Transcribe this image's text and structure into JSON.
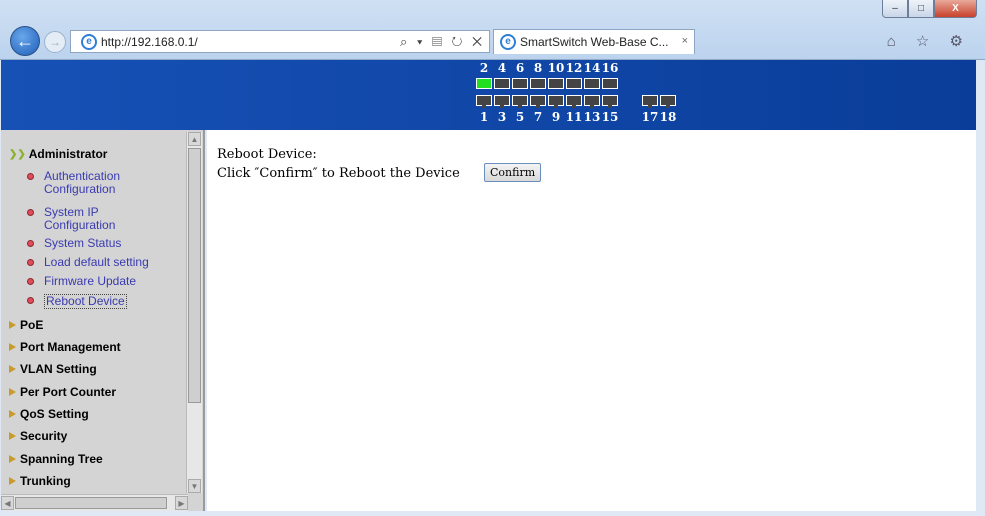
{
  "browser": {
    "url": "http://192.168.0.1/",
    "tab_title": "SmartSwitch Web-Base C...",
    "tab_close": "×",
    "address_tools": "⌕ ▾ ▤ ↻ ✕",
    "right_icons": "⌂ ☆ ⚙",
    "controls": {
      "minimize": "–",
      "maximize": "□",
      "close": "X"
    },
    "ie_icon": "e"
  },
  "ports": {
    "top_labels": [
      "2",
      "4",
      "6",
      "8",
      "10",
      "12",
      "14",
      "16"
    ],
    "bottom_labels": [
      "1",
      "3",
      "5",
      "7",
      "9",
      "11",
      "13",
      "15",
      "17",
      "18"
    ],
    "active_port": "2"
  },
  "sidebar": {
    "open_section": "Administrator",
    "sub_items": [
      "Authentication Configuration",
      "System IP Configuration",
      "System Status",
      "Load default setting",
      "Firmware Update",
      "Reboot Device"
    ],
    "selected_sub_item": "Reboot Device",
    "sections": [
      "PoE",
      "Port Management",
      "VLAN Setting",
      "Per Port Counter",
      "QoS Setting",
      "Security",
      "Spanning Tree",
      "Trunking"
    ]
  },
  "main": {
    "heading": "Reboot Device:",
    "instruction": "Click ″Confirm″ to Reboot the Device",
    "confirm_label": "Confirm"
  },
  "colors": {
    "banner": "#1751b6",
    "active_port": "#22e01f",
    "link": "#3a3ab0",
    "sidebar_bg": "#d4d4d4"
  }
}
